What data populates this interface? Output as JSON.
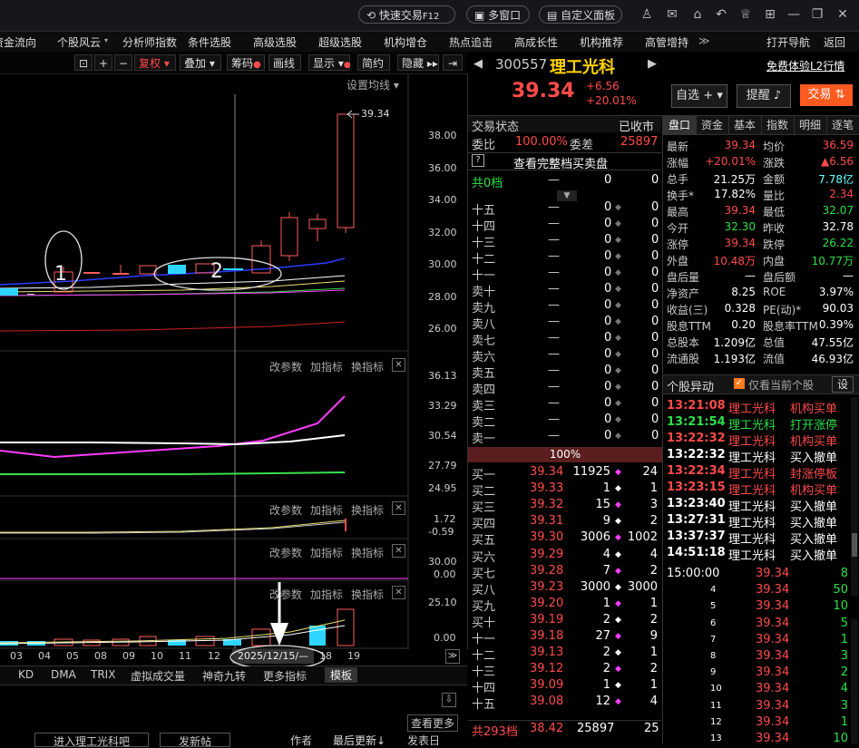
{
  "topbar": {
    "quick_trade": "快速交易",
    "quick_trade_key": "F12",
    "multi_window": "多窗口",
    "custom_panel": "自定义面板"
  },
  "menu": [
    "资金流向",
    "个股风云",
    "分析师指数",
    "条件选股",
    "高级选股",
    "超级选股",
    "机构增仓",
    "热点追击",
    "高成长性",
    "机构推荐",
    "高管增持"
  ],
  "menu_right": [
    "打开导航",
    "返回"
  ],
  "toolbar": {
    "fuquan": "复权",
    "diejia": "叠加",
    "chouma": "筹码",
    "huaxian": "画线",
    "xianshi": "显示",
    "jianyue": "简约",
    "yincang": "隐藏"
  },
  "chart": {
    "setting_ma": "设置均线",
    "ylabels_main": [
      "38.00",
      "36.00",
      "34.00",
      "32.00",
      "30.00",
      "28.00",
      "26.00"
    ],
    "high_label": "39.34",
    "annot1": "1",
    "annot2": "2",
    "panel_btns": [
      "改参数",
      "加指标",
      "换指标"
    ],
    "ylabels_p2": [
      "36.13",
      "33.29",
      "30.54",
      "27.79",
      "24.95"
    ],
    "ylabels_p3": [
      "1.72",
      "-0.59"
    ],
    "ylabels_p4": [
      "30.00",
      "0.00"
    ],
    "ylabels_p5": [
      "25.10",
      "0.00"
    ],
    "xlabels": [
      "03",
      "04",
      "05",
      "08",
      "09",
      "10",
      "11",
      "12",
      "18",
      "19"
    ],
    "cursor_date": "2025/12/15/—",
    "bottom_tabs": [
      "KD",
      "DMA",
      "TRIX",
      "虚拟成交量",
      "神奇九转",
      "更多指标",
      "模板"
    ],
    "forum_see_more": "查看更多",
    "forum_enter": "进入理工光科吧",
    "forum_post": "发新帖",
    "forum_author": "作者",
    "forum_updated": "最后更新",
    "forum_date": "发表日"
  },
  "quote": {
    "code": "300557",
    "name": "理工光科",
    "free_l2": "免费体验L2行情",
    "price": "39.34",
    "change": "+6.56",
    "change_pct": "+20.01%",
    "zixuan": "自选",
    "tixing": "提醒",
    "jiaoyi": "交易"
  },
  "orderbook": {
    "status_label": "交易状态",
    "status_value": "已收市",
    "weibi_label": "委比",
    "weibi_value": "100.00%",
    "weicha_label": "委差",
    "weicha_value": "25897",
    "full_book": "查看完整档买卖盘",
    "total_ask_label": "共0档",
    "total_ask_dash": "—",
    "total_ask_v1": "0",
    "total_ask_v2": "0",
    "asks": [
      {
        "label": "十五",
        "price": "—",
        "vol": "0",
        "cnt": "0"
      },
      {
        "label": "十四",
        "price": "—",
        "vol": "0",
        "cnt": "0"
      },
      {
        "label": "十三",
        "price": "—",
        "vol": "0",
        "cnt": "0"
      },
      {
        "label": "十二",
        "price": "—",
        "vol": "0",
        "cnt": "0"
      },
      {
        "label": "十一",
        "price": "—",
        "vol": "0",
        "cnt": "0"
      },
      {
        "label": "卖十",
        "price": "—",
        "vol": "0",
        "cnt": "0"
      },
      {
        "label": "卖九",
        "price": "—",
        "vol": "0",
        "cnt": "0"
      },
      {
        "label": "卖八",
        "price": "—",
        "vol": "0",
        "cnt": "0"
      },
      {
        "label": "卖七",
        "price": "—",
        "vol": "0",
        "cnt": "0"
      },
      {
        "label": "卖六",
        "price": "—",
        "vol": "0",
        "cnt": "0"
      },
      {
        "label": "卖五",
        "price": "—",
        "vol": "0",
        "cnt": "0"
      },
      {
        "label": "卖四",
        "price": "—",
        "vol": "0",
        "cnt": "0"
      },
      {
        "label": "卖三",
        "price": "—",
        "vol": "0",
        "cnt": "0"
      },
      {
        "label": "卖二",
        "price": "—",
        "vol": "0",
        "cnt": "0"
      },
      {
        "label": "卖一",
        "price": "—",
        "vol": "0",
        "cnt": "0"
      }
    ],
    "ratio_bar": "100%",
    "bids": [
      {
        "label": "买一",
        "price": "39.34",
        "vol": "11925",
        "cnt": "24"
      },
      {
        "label": "买二",
        "price": "39.33",
        "vol": "1",
        "cnt": "1"
      },
      {
        "label": "买三",
        "price": "39.32",
        "vol": "15",
        "cnt": "3"
      },
      {
        "label": "买四",
        "price": "39.31",
        "vol": "9",
        "cnt": "2"
      },
      {
        "label": "买五",
        "price": "39.30",
        "vol": "3006",
        "cnt": "1002"
      },
      {
        "label": "买六",
        "price": "39.29",
        "vol": "4",
        "cnt": "4"
      },
      {
        "label": "买七",
        "price": "39.28",
        "vol": "7",
        "cnt": "2"
      },
      {
        "label": "买八",
        "price": "39.23",
        "vol": "3000",
        "cnt": "3000"
      },
      {
        "label": "买九",
        "price": "39.20",
        "vol": "1",
        "cnt": "1"
      },
      {
        "label": "买十",
        "price": "39.19",
        "vol": "2",
        "cnt": "2"
      },
      {
        "label": "十一",
        "price": "39.18",
        "vol": "27",
        "cnt": "9"
      },
      {
        "label": "十二",
        "price": "39.13",
        "vol": "2",
        "cnt": "1"
      },
      {
        "label": "十三",
        "price": "39.12",
        "vol": "2",
        "cnt": "2"
      },
      {
        "label": "十四",
        "price": "39.09",
        "vol": "1",
        "cnt": "1"
      },
      {
        "label": "十五",
        "price": "39.08",
        "vol": "12",
        "cnt": "4"
      }
    ],
    "total_bid_label": "共293档",
    "total_bid_price": "38.42",
    "total_bid_vol": "25897",
    "total_bid_cnt": "25"
  },
  "detail_tabs": [
    "盘口",
    "资金",
    "基本",
    "指数",
    "明细",
    "逐笔"
  ],
  "detail": [
    {
      "k1": "最新",
      "v1": "39.34",
      "c1": "red",
      "k2": "均价",
      "v2": "36.59",
      "c2": "red"
    },
    {
      "k1": "涨幅",
      "v1": "+20.01%",
      "c1": "red",
      "k2": "涨跌",
      "v2": "▲6.56",
      "c2": "red"
    },
    {
      "k1": "总手",
      "v1": "21.25万",
      "c1": "white",
      "k2": "金额",
      "v2": "7.78亿",
      "c2": "cyan"
    },
    {
      "k1": "换手*",
      "v1": "17.82%",
      "c1": "white",
      "k2": "量比",
      "v2": "2.34",
      "c2": "red"
    },
    {
      "k1": "最高",
      "v1": "39.34",
      "c1": "red",
      "k2": "最低",
      "v2": "32.07",
      "c2": "green"
    },
    {
      "k1": "今开",
      "v1": "32.30",
      "c1": "green",
      "k2": "昨收",
      "v2": "32.78",
      "c2": "white"
    },
    {
      "k1": "涨停",
      "v1": "39.34",
      "c1": "red",
      "k2": "跌停",
      "v2": "26.22",
      "c2": "green"
    },
    {
      "k1": "外盘",
      "v1": "10.48万",
      "c1": "red",
      "k2": "内盘",
      "v2": "10.77万",
      "c2": "green"
    },
    {
      "k1": "盘后量",
      "v1": "—",
      "c1": "white",
      "k2": "盘后额",
      "v2": "—",
      "c2": "white"
    },
    {
      "k1": "净资产",
      "v1": "8.25",
      "c1": "white",
      "k2": "ROE",
      "v2": "3.97%",
      "c2": "white"
    },
    {
      "k1": "收益(三)",
      "v1": "0.328",
      "c1": "white",
      "k2": "PE(动)*",
      "v2": "90.03",
      "c2": "white"
    },
    {
      "k1": "股息TTM",
      "v1": "0.20",
      "c1": "white",
      "k2": "股息率TTM",
      "v2": "0.39%",
      "c2": "white"
    },
    {
      "k1": "总股本",
      "v1": "1.209亿",
      "c1": "white",
      "k2": "总值",
      "v2": "47.55亿",
      "c2": "white"
    },
    {
      "k1": "流通股",
      "v1": "1.193亿",
      "c1": "white",
      "k2": "流值",
      "v2": "46.93亿",
      "c2": "white"
    }
  ],
  "alerts_header": {
    "title": "个股异动",
    "only_current": "仅看当前个股",
    "settings": "设"
  },
  "alerts": [
    {
      "time": "13:21:08",
      "name": "理工光科",
      "event": "机构买单",
      "color": "red"
    },
    {
      "time": "13:21:54",
      "name": "理工光科",
      "event": "打开涨停",
      "color": "green"
    },
    {
      "time": "13:22:32",
      "name": "理工光科",
      "event": "机构买单",
      "color": "red"
    },
    {
      "time": "13:22:32",
      "name": "理工光科",
      "event": "买入撤单",
      "color": "white"
    },
    {
      "time": "13:22:34",
      "name": "理工光科",
      "event": "封涨停板",
      "color": "red"
    },
    {
      "time": "13:23:15",
      "name": "理工光科",
      "event": "机构买单",
      "color": "red"
    },
    {
      "time": "13:23:40",
      "name": "理工光科",
      "event": "买入撤单",
      "color": "white"
    },
    {
      "time": "13:27:31",
      "name": "理工光科",
      "event": "买入撤单",
      "color": "white"
    },
    {
      "time": "13:37:37",
      "name": "理工光科",
      "event": "买入撤单",
      "color": "white"
    },
    {
      "time": "14:51:18",
      "name": "理工光科",
      "event": "买入撤单",
      "color": "white"
    }
  ],
  "ticks": [
    {
      "t": "15:00:00",
      "p": "39.34",
      "v": "8"
    },
    {
      "t": "4",
      "p": "39.34",
      "v": "50"
    },
    {
      "t": "5",
      "p": "39.34",
      "v": "10"
    },
    {
      "t": "6",
      "p": "39.34",
      "v": "5"
    },
    {
      "t": "7",
      "p": "39.34",
      "v": "1"
    },
    {
      "t": "8",
      "p": "39.34",
      "v": "3"
    },
    {
      "t": "9",
      "p": "39.34",
      "v": "2"
    },
    {
      "t": "10",
      "p": "39.34",
      "v": "4"
    },
    {
      "t": "11",
      "p": "39.34",
      "v": "3"
    },
    {
      "t": "12",
      "p": "39.34",
      "v": "1"
    },
    {
      "t": "13",
      "p": "39.34",
      "v": "10"
    }
  ]
}
